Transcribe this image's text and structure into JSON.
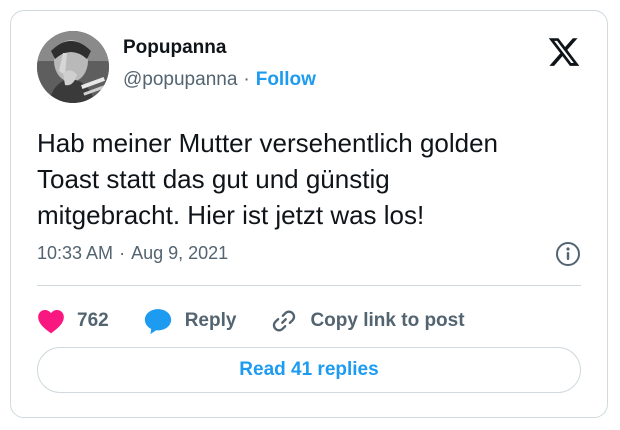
{
  "author": {
    "display_name": "Popupanna",
    "handle": "@popupanna",
    "separator": "·",
    "follow_label": "Follow",
    "avatar_icon": "profile-photo"
  },
  "brand": {
    "logo_icon": "x-logo-icon"
  },
  "tweet": {
    "lines": [
      "Hab meiner Mutter versehentlich golden",
      "Toast statt das gut und günstig",
      "mitgebracht. Hier ist jetzt was los!"
    ],
    "time": "10:33 AM",
    "separator": "·",
    "date": "Aug 9, 2021",
    "info_icon": "info-icon"
  },
  "actions": {
    "like_count": "762",
    "like_icon": "heart-icon",
    "reply_label": "Reply",
    "reply_icon": "speech-bubble-icon",
    "copy_label": "Copy link to post",
    "copy_icon": "link-icon"
  },
  "footer": {
    "read_replies_label": "Read 41 replies"
  },
  "colors": {
    "accent": "#1d9bf0",
    "like": "#f91880",
    "text": "#0f1419",
    "secondary_text": "#536471",
    "border": "#cfd9de"
  }
}
